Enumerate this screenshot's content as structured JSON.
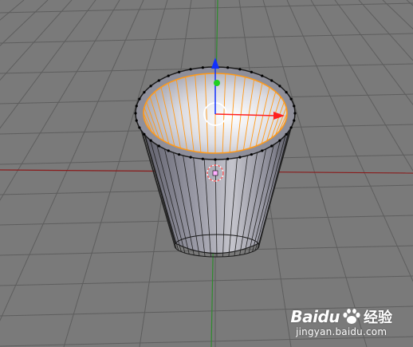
{
  "watermark": {
    "brand": "Baidu",
    "cn_label": "经验",
    "url": "jingyan.baidu.com",
    "logo_icon": "paw-icon"
  },
  "colors": {
    "background": "#7a7a7a",
    "grid": "#5e5e5e",
    "x_axis": "#8a1c1c",
    "y_axis": "#2e8a2e",
    "selected_edge": "#ff9a1a",
    "vertex": "#000000",
    "gizmo_x": "#ff2020",
    "gizmo_z": "#1030ff",
    "gizmo_y": "#20d020"
  },
  "icons": [
    "paw-icon",
    "transform-gizmo-icon",
    "3d-cursor-icon"
  ]
}
